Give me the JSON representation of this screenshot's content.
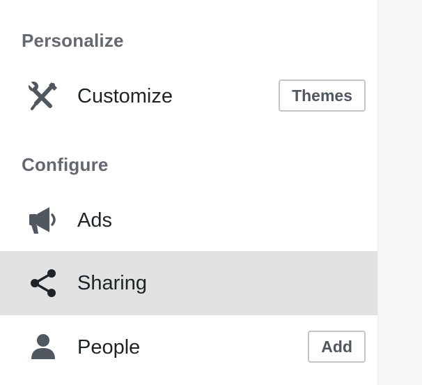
{
  "sections": {
    "personalize": {
      "heading": "Personalize",
      "items": [
        {
          "label": "Customize",
          "icon": "tools-icon",
          "button": "Themes"
        }
      ]
    },
    "configure": {
      "heading": "Configure",
      "items": [
        {
          "label": "Ads",
          "icon": "megaphone-icon"
        },
        {
          "label": "Sharing",
          "icon": "share-icon",
          "selected": true
        },
        {
          "label": "People",
          "icon": "person-icon",
          "button": "Add"
        }
      ]
    }
  },
  "colors": {
    "heading": "#646970",
    "label": "#1d2327",
    "icon": "#50575e",
    "selected_bg": "#e1e2e2",
    "right_panel_bg": "#f6f6f6"
  }
}
